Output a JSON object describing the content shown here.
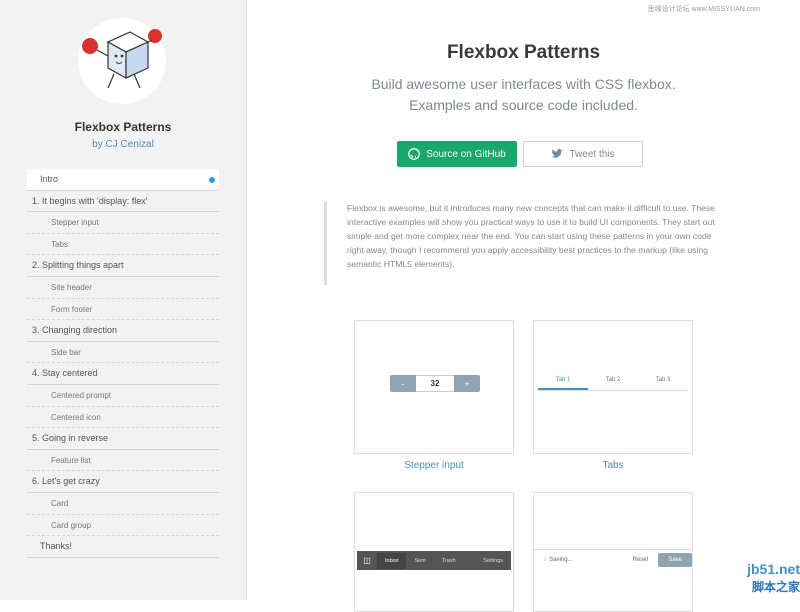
{
  "sidebar": {
    "brand_title": "Flexbox Patterns",
    "brand_author": "by CJ Cenizal",
    "nav": [
      {
        "label": "Intro",
        "type": "top",
        "active": true
      },
      {
        "label": "1. It begins with 'display: flex'",
        "type": "sec"
      },
      {
        "label": "Stepper input",
        "type": "sub"
      },
      {
        "label": "Tabs",
        "type": "sub"
      },
      {
        "label": "2. Splitting things apart",
        "type": "sec"
      },
      {
        "label": "Site header",
        "type": "sub"
      },
      {
        "label": "Form footer",
        "type": "sub"
      },
      {
        "label": "3. Changing direction",
        "type": "sec"
      },
      {
        "label": "Side bar",
        "type": "sub"
      },
      {
        "label": "4. Stay centered",
        "type": "sec"
      },
      {
        "label": "Centered prompt",
        "type": "sub"
      },
      {
        "label": "Centered icon",
        "type": "sub"
      },
      {
        "label": "5. Going in reverse",
        "type": "sec"
      },
      {
        "label": "Feature list",
        "type": "sub"
      },
      {
        "label": "6. Let's get crazy",
        "type": "sec"
      },
      {
        "label": "Card",
        "type": "sub"
      },
      {
        "label": "Card group",
        "type": "sub"
      },
      {
        "label": "Thanks!",
        "type": "top"
      }
    ]
  },
  "main": {
    "watermark_top": "思缘设计论坛 www.MISSYUAN.com",
    "title": "Flexbox Patterns",
    "tagline_1": "Build awesome user interfaces with CSS flexbox.",
    "tagline_2": "Examples and source code included.",
    "github_label": "Source on GitHub",
    "tweet_label": "Tweet this",
    "intro": "Flexbox is awesome, but it introduces many new concepts that can make it difficult to use. These interactive examples will show you practical ways to use it to build UI components. They start out simple and get more complex near the end. You can start using these patterns in your own code right away, though I recommend you apply accessibility best practices to the markup (like using semantic HTML5 elements).",
    "cards": {
      "stepper_caption": "Stepper input",
      "stepper_minus": "-",
      "stepper_value": "32",
      "stepper_plus": "+",
      "tabs_caption": "Tabs",
      "tabs": [
        "Tab 1",
        "Tab 2",
        "Tab 3"
      ],
      "header_items": [
        "Inbox",
        "Sent",
        "Trash"
      ],
      "header_settings": "Settings",
      "footer_saving": "Saving...",
      "footer_reset": "Reset",
      "footer_save": "Save"
    },
    "watermark_br_1": "jb51.net",
    "watermark_br_2": "脚本之家"
  },
  "colors": {
    "accent": "#2e9cdb",
    "github_green": "#1aa76a",
    "link": "#4a90b8"
  }
}
